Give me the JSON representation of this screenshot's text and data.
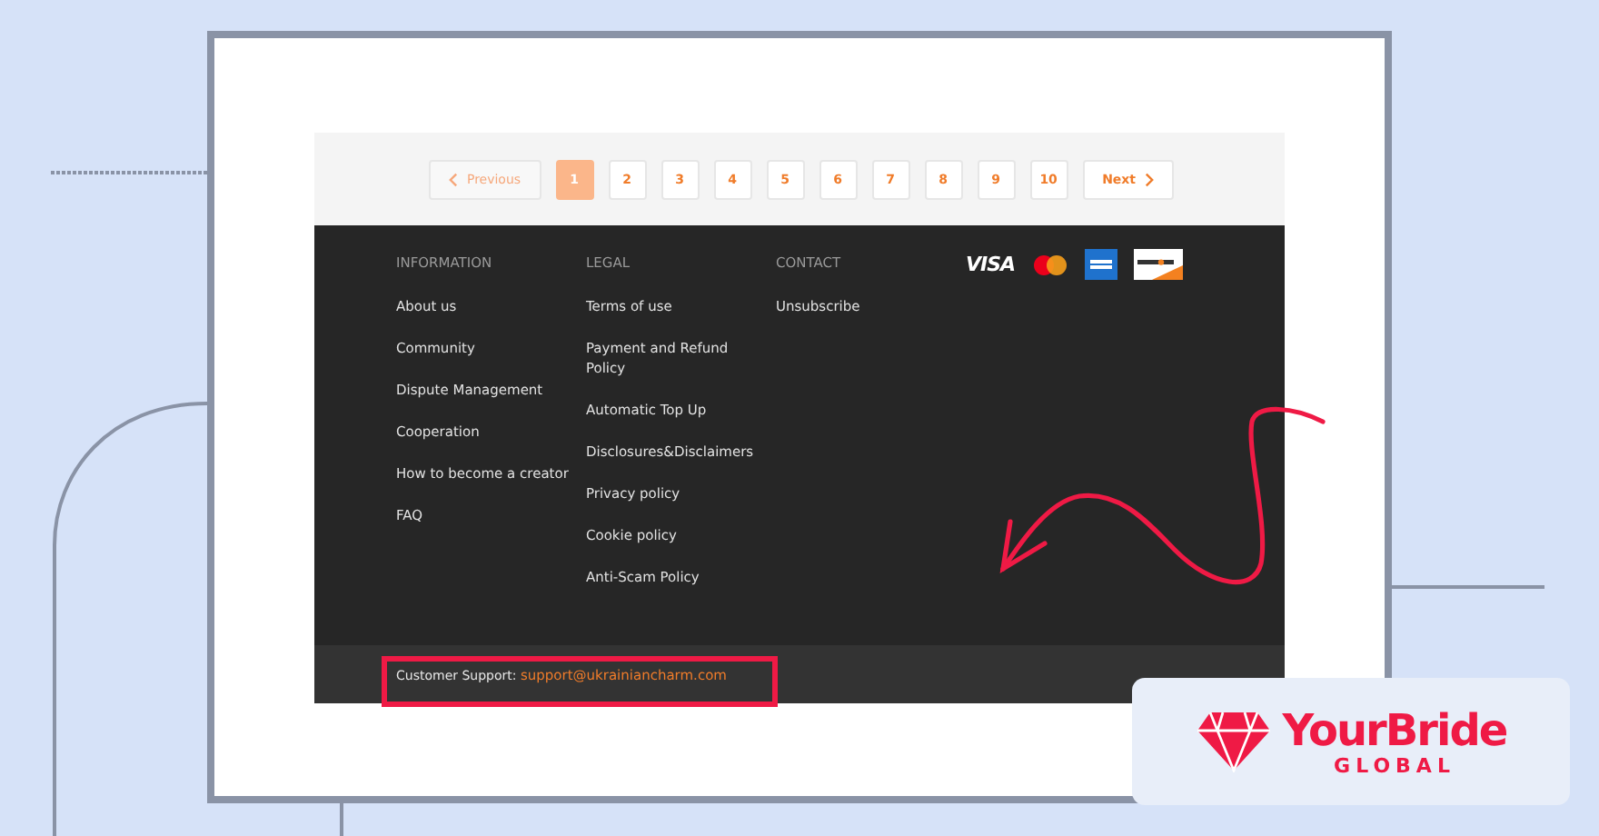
{
  "pagination": {
    "previous": {
      "label": "Previous",
      "disabled": true
    },
    "pages": [
      {
        "label": "1",
        "selected": true
      },
      {
        "label": "2",
        "selected": false
      },
      {
        "label": "3",
        "selected": false
      },
      {
        "label": "4",
        "selected": false
      },
      {
        "label": "5",
        "selected": false
      },
      {
        "label": "6",
        "selected": false
      },
      {
        "label": "7",
        "selected": false
      },
      {
        "label": "8",
        "selected": false
      },
      {
        "label": "9",
        "selected": false
      },
      {
        "label": "10",
        "selected": false
      }
    ],
    "next": {
      "label": "Next",
      "disabled": false
    }
  },
  "footer": {
    "columns": [
      {
        "heading": "INFORMATION",
        "links": [
          "About us",
          "Community",
          "Dispute Management",
          "Cooperation",
          "How to become a creator",
          "FAQ"
        ]
      },
      {
        "heading": "LEGAL",
        "links": [
          "Terms of use",
          "Payment and Refund Policy",
          "Automatic Top Up",
          "Disclosures&Disclaimers",
          "Privacy policy",
          "Cookie policy",
          "Anti-Scam Policy"
        ]
      },
      {
        "heading": "CONTACT",
        "links": [
          "Unsubscribe"
        ]
      }
    ],
    "payment_logos": [
      {
        "kind": "visa",
        "text": "VISA"
      },
      {
        "kind": "mastercard"
      },
      {
        "kind": "amex"
      },
      {
        "kind": "discover"
      }
    ]
  },
  "support_bar": {
    "label": "Customer Support:",
    "email": "support@ukrainiancharm.com",
    "highlighted": true
  },
  "brand": {
    "name": "YourBride",
    "tagline": "GLOBAL"
  }
}
